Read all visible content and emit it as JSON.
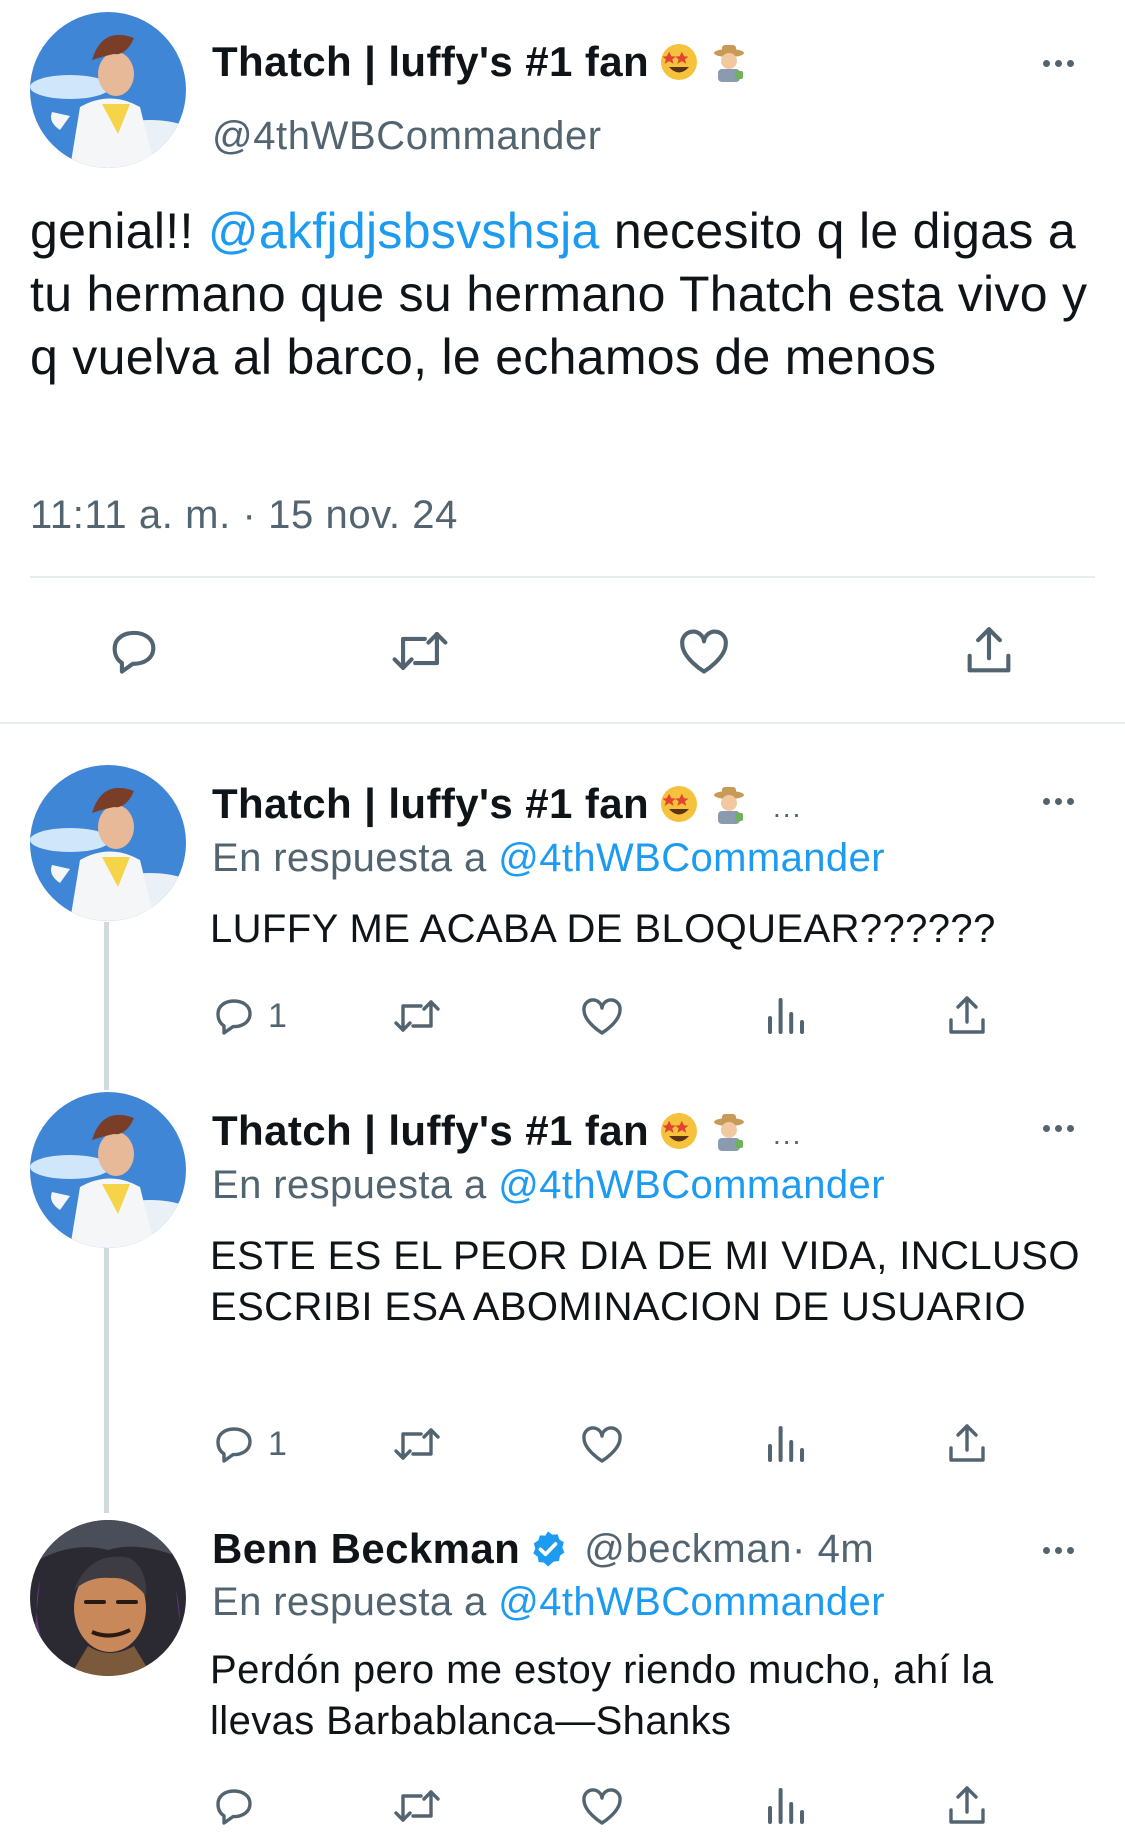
{
  "main_tweet": {
    "display_name": "Thatch | luffy's #1 fan",
    "handle": "@4thWBCommander",
    "text_before": "genial!! ",
    "mention": "@akfjdjsbsvshsja",
    "text_after": " necesito q le digas a tu hermano que su hermano Thatch esta vivo y q vuelva al barco, le echamos de menos",
    "timestamp": "11:11 a. m. · 15 nov. 24"
  },
  "replies": [
    {
      "display_name": "Thatch | luffy's #1 fan",
      "trailing": "...",
      "reply_prefix": "En respuesta a ",
      "reply_mention": "@4thWBCommander",
      "text": "LUFFY ME ACABA DE BLOQUEAR??????",
      "reply_count": "1"
    },
    {
      "display_name": "Thatch | luffy's #1 fan",
      "trailing": "...",
      "reply_prefix": "En respuesta a ",
      "reply_mention": "@4thWBCommander",
      "text": "ESTE ES EL PEOR DIA DE MI VIDA, INCLUSO ESCRIBI ESA ABOMINACION DE USUARIO",
      "reply_count": "1"
    },
    {
      "display_name": "Benn Beckman",
      "handle": "@beckman",
      "time": " · 4m",
      "reply_prefix": "En respuesta a ",
      "reply_mention": "@4thWBCommander",
      "text": "Perdón pero me estoy riendo mucho, ahí la llevas Barbablanca—Shanks"
    }
  ],
  "icons": {
    "reply": "reply-icon",
    "retweet": "retweet-icon",
    "like": "heart-icon",
    "views": "views-icon",
    "share": "share-icon",
    "more": "more-icon",
    "verified": "verified-badge-icon"
  },
  "colors": {
    "link": "#1d9bf0",
    "secondary_text": "#536471",
    "icon": "#536471"
  }
}
